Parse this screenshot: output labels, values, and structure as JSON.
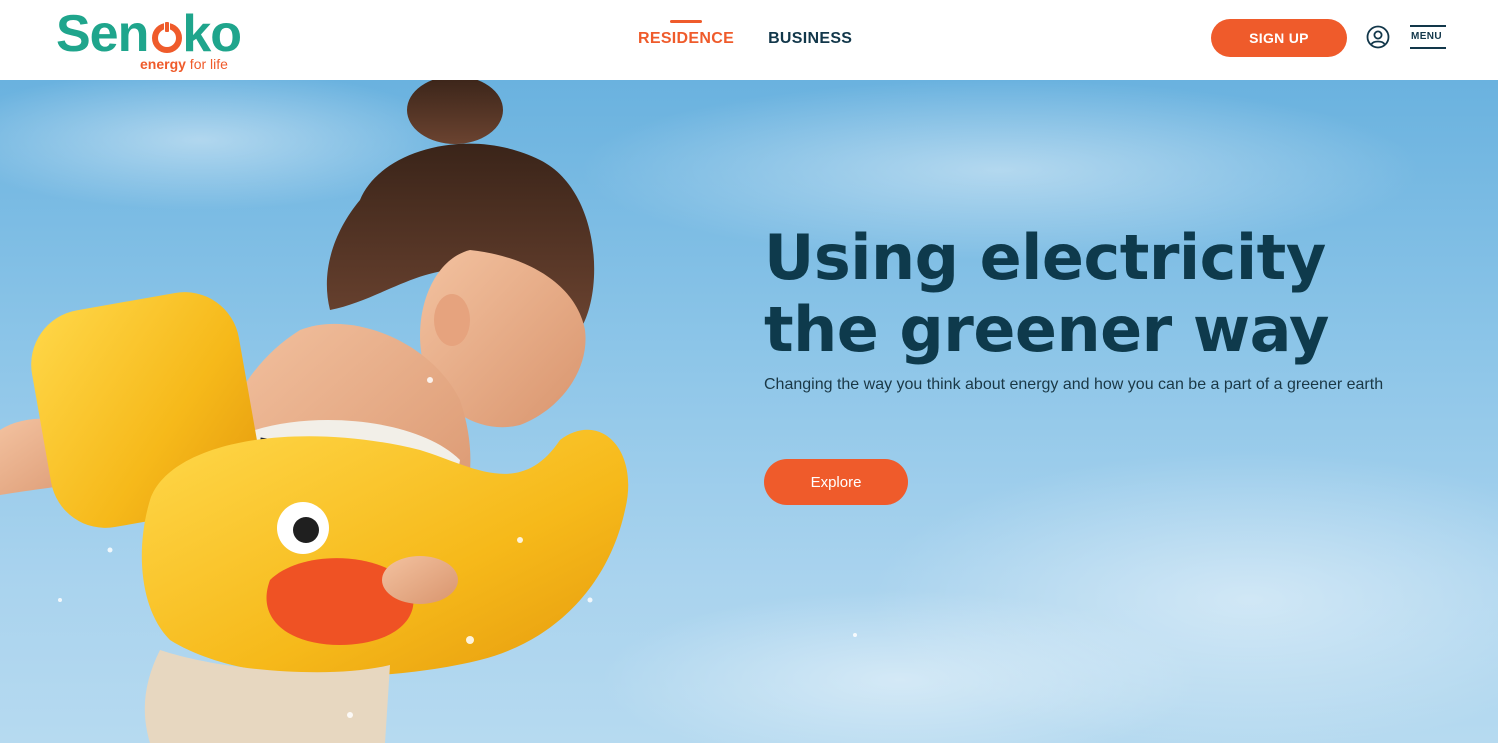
{
  "brand": {
    "name_part1": "Sen",
    "name_part2": "ko",
    "tagline_bold": "energy",
    "tagline_rest": " for life",
    "primary_color": "#1fa58c",
    "accent_color": "#ef5b2b",
    "logo_icon": "power-o-icon"
  },
  "nav": {
    "items": [
      {
        "label": "RESIDENCE",
        "active": true
      },
      {
        "label": "BUSINESS",
        "active": false
      }
    ]
  },
  "header": {
    "signup_label": "SIGN UP",
    "user_icon": "user-circle-icon",
    "menu_label": "MENU"
  },
  "hero": {
    "title_line1": "Using electricity",
    "title_line2": "the greener way",
    "subtitle": "Changing the way you think about energy and how you can be a part of a greener earth",
    "cta_label": "Explore",
    "title_color": "#0e3a4c"
  }
}
